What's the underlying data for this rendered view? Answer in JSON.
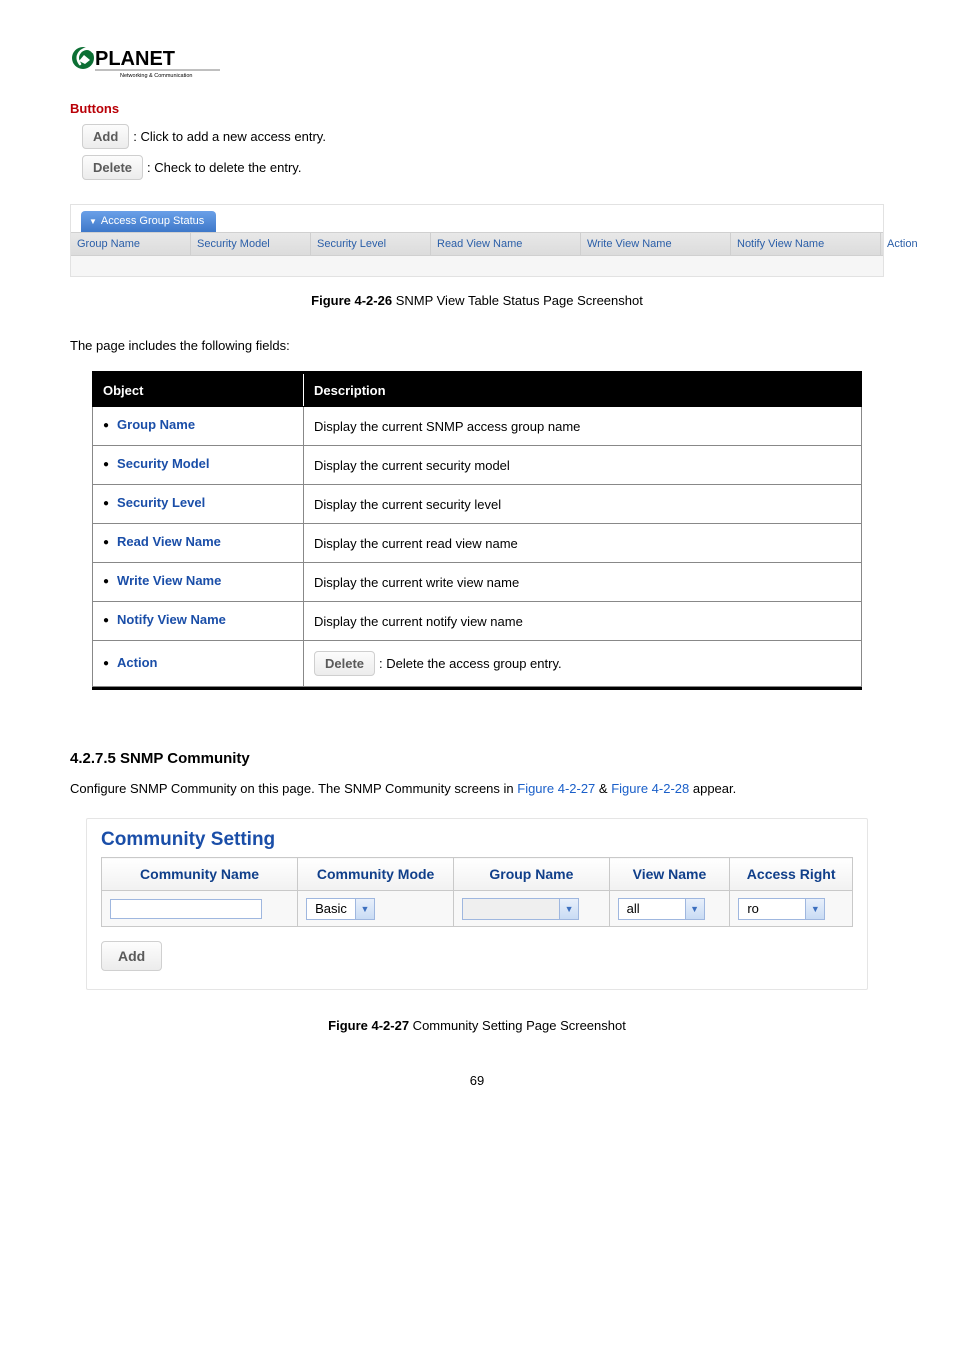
{
  "logo": {
    "brand": "PLANET",
    "tag": "Networking & Communication"
  },
  "buttons": {
    "heading": "Buttons",
    "add_label": "Add",
    "add_desc": ": Click to add a new access entry.",
    "del_label": "Delete",
    "del_desc": ": Check to delete the entry."
  },
  "ags": {
    "tab": "Access Group Status",
    "headers": [
      "Group Name",
      "Security Model",
      "Security Level",
      "Read View Name",
      "Write View Name",
      "Notify View Name",
      "Action"
    ]
  },
  "fig1": {
    "bold": "Figure 4-2-26",
    "rest": " SNMP View Table Status Page Screenshot"
  },
  "intro": "The page includes the following fields:",
  "table": {
    "head_obj": "Object",
    "head_desc": "Description",
    "rows": [
      {
        "name": "Group Name",
        "desc": "Display the current SNMP access group name"
      },
      {
        "name": "Security Model",
        "desc": "Display the current security model"
      },
      {
        "name": "Security Level",
        "desc": "Display the current security level"
      },
      {
        "name": "Read View Name",
        "desc": "Display the current read view name"
      },
      {
        "name": "Write View Name",
        "desc": "Display the current write view name"
      },
      {
        "name": "Notify View Name",
        "desc": "Display the current notify view name"
      }
    ],
    "action_row": {
      "name": "Action",
      "btn": "Delete",
      "desc": ": Delete the access group entry."
    }
  },
  "section": {
    "heading": "4.2.7.5 SNMP Community",
    "para_pre": "Configure SNMP Community on this page. The SNMP Community screens in ",
    "link1": "Figure 4-2-27",
    "amp": " & ",
    "link2": "Figure 4-2-28",
    "para_post": " appear."
  },
  "cs": {
    "title": "Community Setting",
    "headers": [
      "Community Name",
      "Community Mode",
      "Group Name",
      "View Name",
      "Access Right"
    ],
    "row": {
      "community_mode": "Basic",
      "group_name": "",
      "view_name": "all",
      "access_right": "ro"
    },
    "add": "Add"
  },
  "fig2": {
    "bold": "Figure 4-2-27",
    "rest": " Community Setting Page Screenshot"
  },
  "pagenum": "69"
}
